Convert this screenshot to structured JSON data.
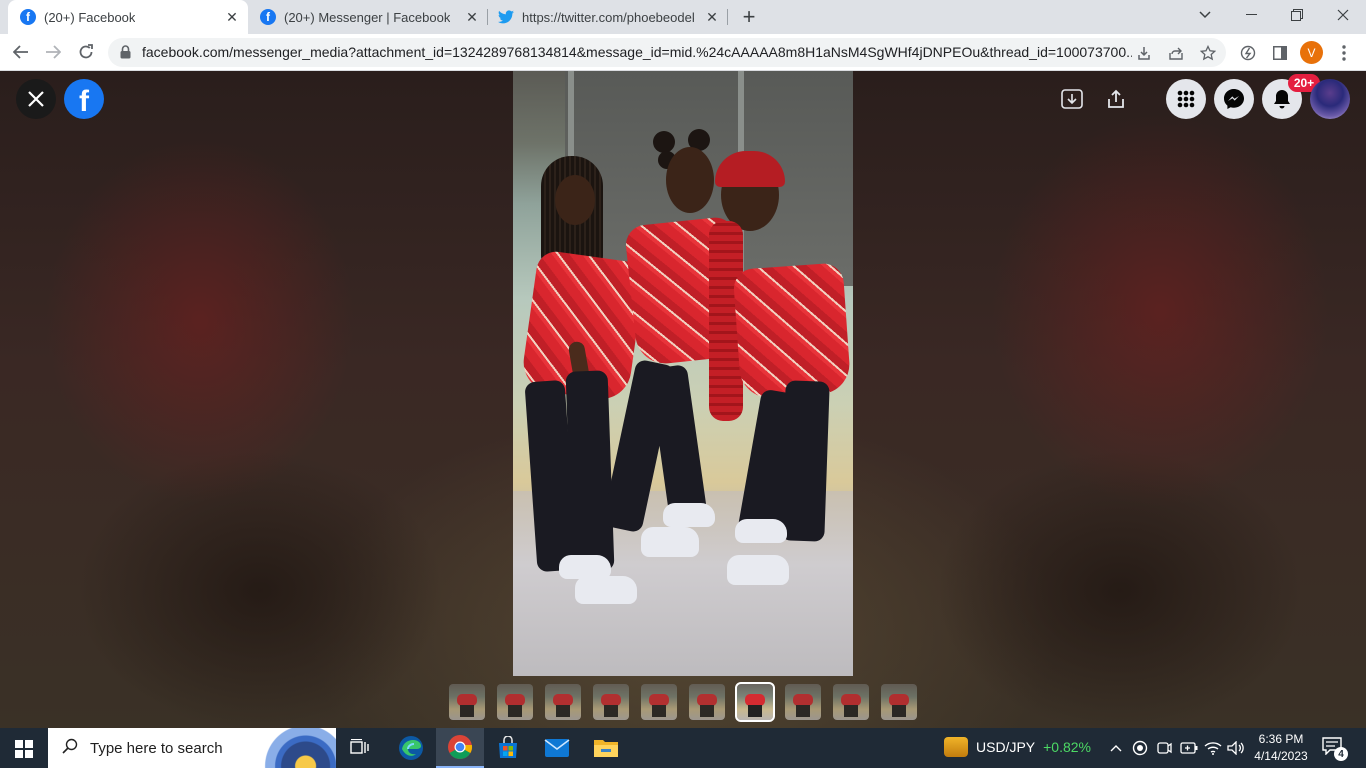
{
  "browser": {
    "tabs": [
      {
        "title": "(20+) Facebook",
        "favicon": "facebook-icon",
        "active": true
      },
      {
        "title": "(20+) Messenger | Facebook",
        "favicon": "facebook-icon",
        "active": false
      },
      {
        "title": "https://twitter.com/phoebeodek",
        "favicon": "twitter-icon",
        "active": false
      }
    ],
    "new_tab_symbol": "+",
    "url": "facebook.com/messenger_media?attachment_id=1324289768134814&message_id=mid.%24cAAAAA8m8H1aNsM4SgWHf4jDNPEOu&thread_id=100073700...",
    "profile_initial": "V",
    "accent": "#1877f2"
  },
  "viewer": {
    "notification_badge": "20+",
    "thumbnail_count": 10,
    "selected_thumbnail": 7
  },
  "taskbar": {
    "search_placeholder": "Type here to search",
    "ticker_pair": "USD/JPY",
    "ticker_change": "+0.82%",
    "time": "6:36 PM",
    "date": "4/14/2023",
    "notification_count": "4"
  }
}
